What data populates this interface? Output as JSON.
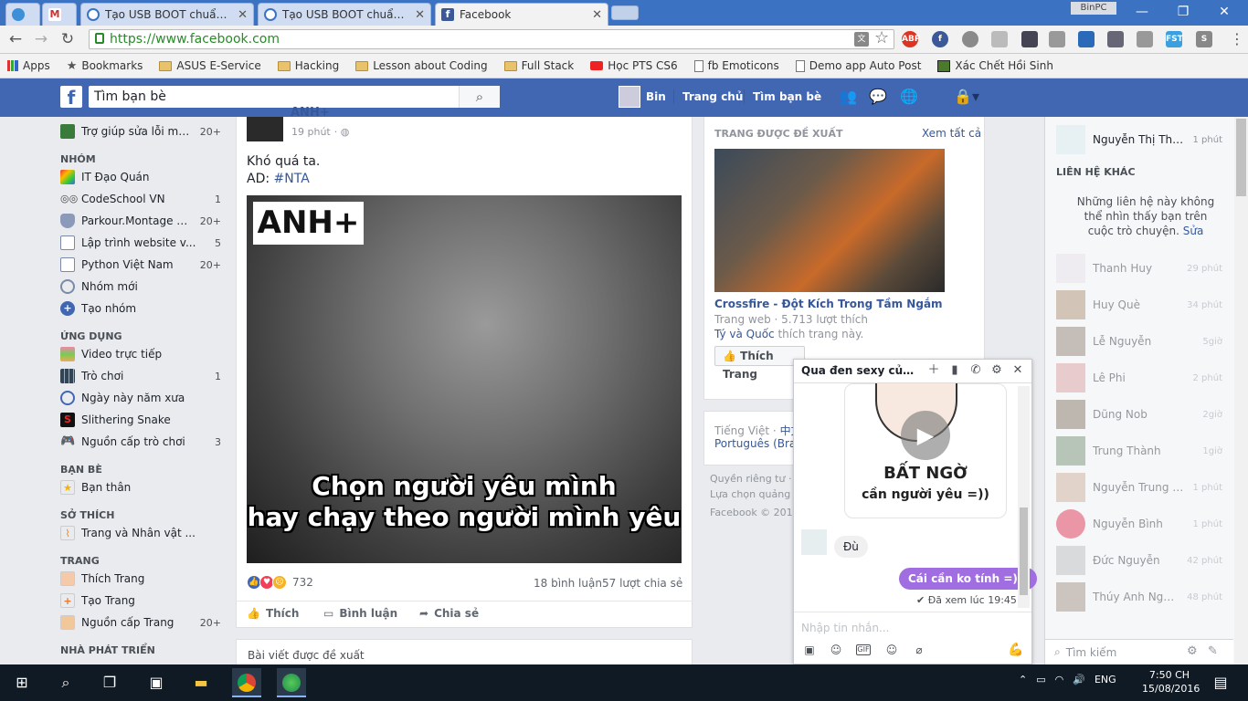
{
  "browser": {
    "tabs": [
      {
        "title": ""
      },
      {
        "title": ""
      },
      {
        "title": "Tạo USB BOOT chuẩn UEF"
      },
      {
        "title": "Tạo USB BOOT chuẩn UEF"
      },
      {
        "title": "Facebook"
      }
    ],
    "profile_name": "BinPC",
    "url": "https://www.facebook.com",
    "extensions": [
      "ABP",
      "FST"
    ],
    "bookmarks": [
      {
        "label": "Apps"
      },
      {
        "label": "Bookmarks"
      },
      {
        "label": "ASUS E-Service"
      },
      {
        "label": "Hacking"
      },
      {
        "label": "Lesson about Coding"
      },
      {
        "label": "Full Stack"
      },
      {
        "label": "Học PTS CS6"
      },
      {
        "label": "fb Emoticons"
      },
      {
        "label": "Demo app Auto Post"
      },
      {
        "label": "Xác Chết Hồi Sinh"
      }
    ]
  },
  "fb_header": {
    "logo": "f",
    "search_placeholder": "Tìm bạn bè",
    "user": "Bin",
    "home": "Trang chủ",
    "find_friends": "Tìm bạn bè"
  },
  "left_nav": {
    "top_item": {
      "label": "Trợ giúp sửa lỗi má...",
      "count": "20+"
    },
    "groups_title": "NHÓM",
    "groups": [
      {
        "label": "IT Đạo Quán",
        "count": ""
      },
      {
        "label": "CodeSchool VN",
        "count": "1"
      },
      {
        "label": "Parkour.Montage đ...",
        "count": "20+"
      },
      {
        "label": "Lập trình website v...",
        "count": "5"
      },
      {
        "label": "Python Việt Nam",
        "count": "20+"
      },
      {
        "label": "Nhóm mới",
        "count": ""
      },
      {
        "label": "Tạo nhóm",
        "count": ""
      }
    ],
    "apps_title": "ỨNG DỤNG",
    "apps": [
      {
        "label": "Video trực tiếp",
        "count": ""
      },
      {
        "label": "Trò chơi",
        "count": "1"
      },
      {
        "label": "Ngày này năm xưa",
        "count": ""
      },
      {
        "label": "Slithering Snake",
        "count": ""
      },
      {
        "label": "Nguồn cấp trò chơi",
        "count": "3"
      }
    ],
    "friends_title": "BẠN BÈ",
    "friends": [
      {
        "label": "Bạn thân",
        "count": ""
      }
    ],
    "interests_title": "SỞ THÍCH",
    "interests": [
      {
        "label": "Trang và Nhân vật ...",
        "count": ""
      }
    ],
    "pages_title": "TRANG",
    "pages": [
      {
        "label": "Thích Trang",
        "count": ""
      },
      {
        "label": "Tạo Trang",
        "count": ""
      },
      {
        "label": "Nguồn cấp Trang",
        "count": "20+"
      }
    ],
    "dev_title": "NHÀ PHÁT TRIỂN"
  },
  "post": {
    "author": "ANH+",
    "time": "19 phút",
    "text_line1": "Khó quá ta.",
    "text_line2_prefix": "AD: ",
    "hashtag": "#NTA",
    "image_logo": "ANH+",
    "caption_line1": "Chọn người yêu mình",
    "caption_line2": "hay chạy theo người mình yêu",
    "reactions_count": "732",
    "comments": "18 bình luận",
    "shares": "57 lượt chia sẻ",
    "like_label": "Thích",
    "comment_label": "Bình luận",
    "share_label": "Chia sẻ",
    "suggested_label": "Bài viết được đề xuất"
  },
  "right_col": {
    "suggested_title": "TRANG ĐƯỢC ĐỀ XUẤT",
    "see_all": "Xem tất cả",
    "page_name": "Crossfire - Đột Kích Trong Tầm Ngắm",
    "page_meta": "Trang web · 5.713 lượt thích",
    "friends_like_names": "Tý và Quốc",
    "friends_like_suffix": " thích trang này.",
    "like_page_btn": "Thích Trang",
    "lang_current": "Tiếng Việt",
    "lang_other1": "中文",
    "lang_other2": "Português (Bras",
    "footer1": "Quyền riêng tư ·",
    "footer2": "Lựa chọn quảng",
    "footer3": "Facebook © 201"
  },
  "chat_sidebar": {
    "top_contact": {
      "name": "Nguyễn Thị Tha...",
      "time": "1 phút"
    },
    "other_title": "LIÊN HỆ KHÁC",
    "other_note": "Những liên hệ này không thể nhìn thấy bạn trên cuộc trò chuyện.",
    "other_note_link": "Sửa",
    "contacts": [
      {
        "name": "Thanh Huy",
        "time": "29 phút"
      },
      {
        "name": "Huy Què",
        "time": "34 phút"
      },
      {
        "name": "Lễ Nguyễn",
        "time": "5giờ"
      },
      {
        "name": "Lê Phi",
        "time": "2 phút"
      },
      {
        "name": "Dũng Nob",
        "time": "2giờ"
      },
      {
        "name": "Trung Thành",
        "time": "1giờ"
      },
      {
        "name": "Nguyễn Trung T...",
        "time": "1 phút"
      },
      {
        "name": "Nguyễn Bình",
        "time": "1 phút"
      },
      {
        "name": "Đức Nguyễn",
        "time": "42 phút"
      },
      {
        "name": "Thúy Anh Nguyễn",
        "time": "48 phút"
      }
    ],
    "search_placeholder": "Tìm kiếm"
  },
  "chat_window": {
    "title": "Qua đen sexy của ...",
    "sticker_text1": "BẤT NGỜ",
    "sticker_text2": "cần người yêu =))",
    "msg_in": "Đù",
    "msg_out": "Cái cần ko tính =)))",
    "seen": "✔ Đã xem lúc 19:45",
    "input_placeholder": "Nhập tin nhắn..."
  },
  "taskbar": {
    "lang": "ENG",
    "time": "7:50 CH",
    "date": "15/08/2016"
  },
  "colors": {
    "fb_blue": "#4267b2",
    "link": "#365899",
    "chat_bubble": "#a06ee0"
  }
}
